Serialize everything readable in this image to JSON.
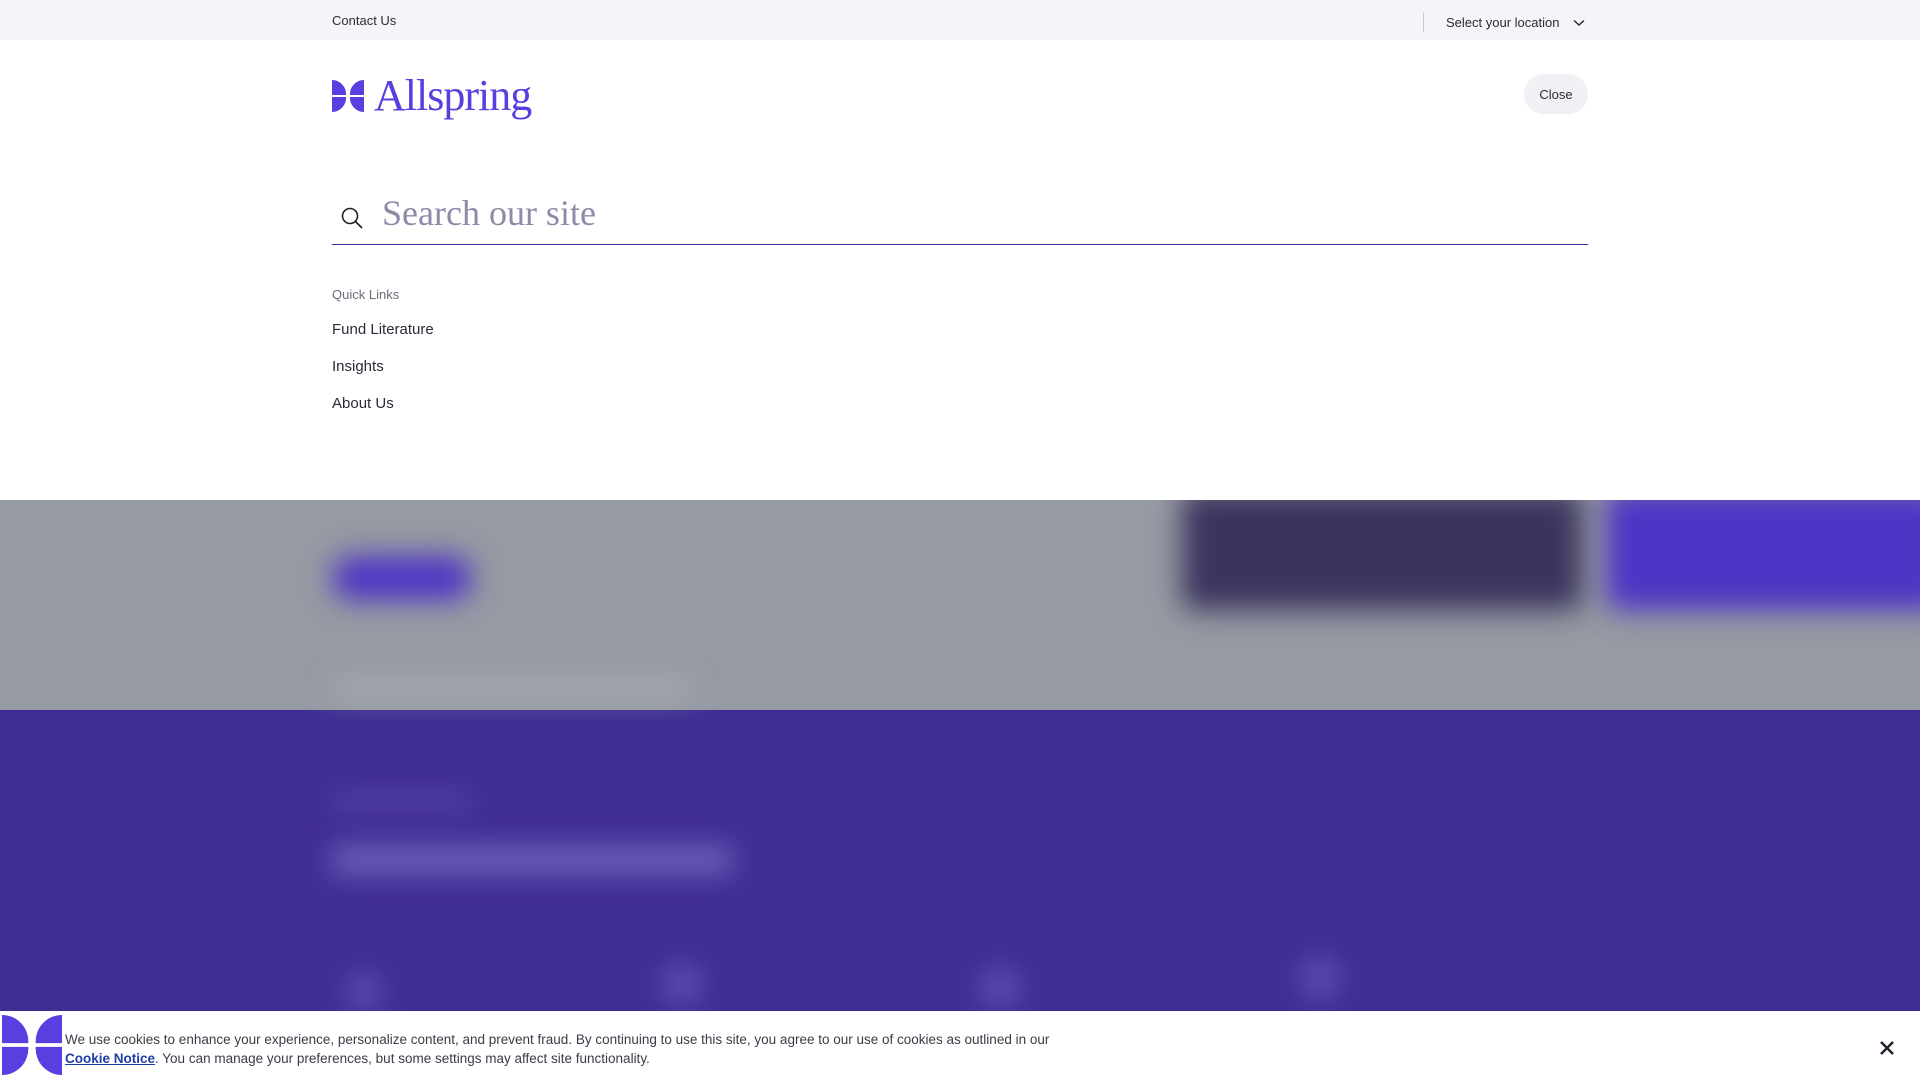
{
  "utility_bar": {
    "contact_label": "Contact Us",
    "location_label": "Select your location"
  },
  "header": {
    "logo_text": "Allspring",
    "close_label": "Close"
  },
  "search": {
    "placeholder": "Search our site",
    "value": ""
  },
  "quick_links": {
    "heading": "Quick Links",
    "items": [
      {
        "label": "Fund Literature"
      },
      {
        "label": "Insights"
      },
      {
        "label": "About Us"
      }
    ]
  },
  "cookie_banner": {
    "text_before": "We use cookies to enhance your experience, personalize content, and prevent fraud. By continuing to use this site, you agree to our use of cookies as outlined in our ",
    "link_label": "Cookie Notice",
    "text_after": ". You can manage your preferences, but some settings may affect site functionality."
  },
  "colors": {
    "brand_purple": "#5a3ee0",
    "band_purple": "#412e94",
    "overlay_gray": "#969aa3",
    "link_blue": "#1f3ea8"
  },
  "icons": [
    "chevron-down-icon",
    "allspring-logo-icon",
    "search-icon",
    "close-icon"
  ]
}
